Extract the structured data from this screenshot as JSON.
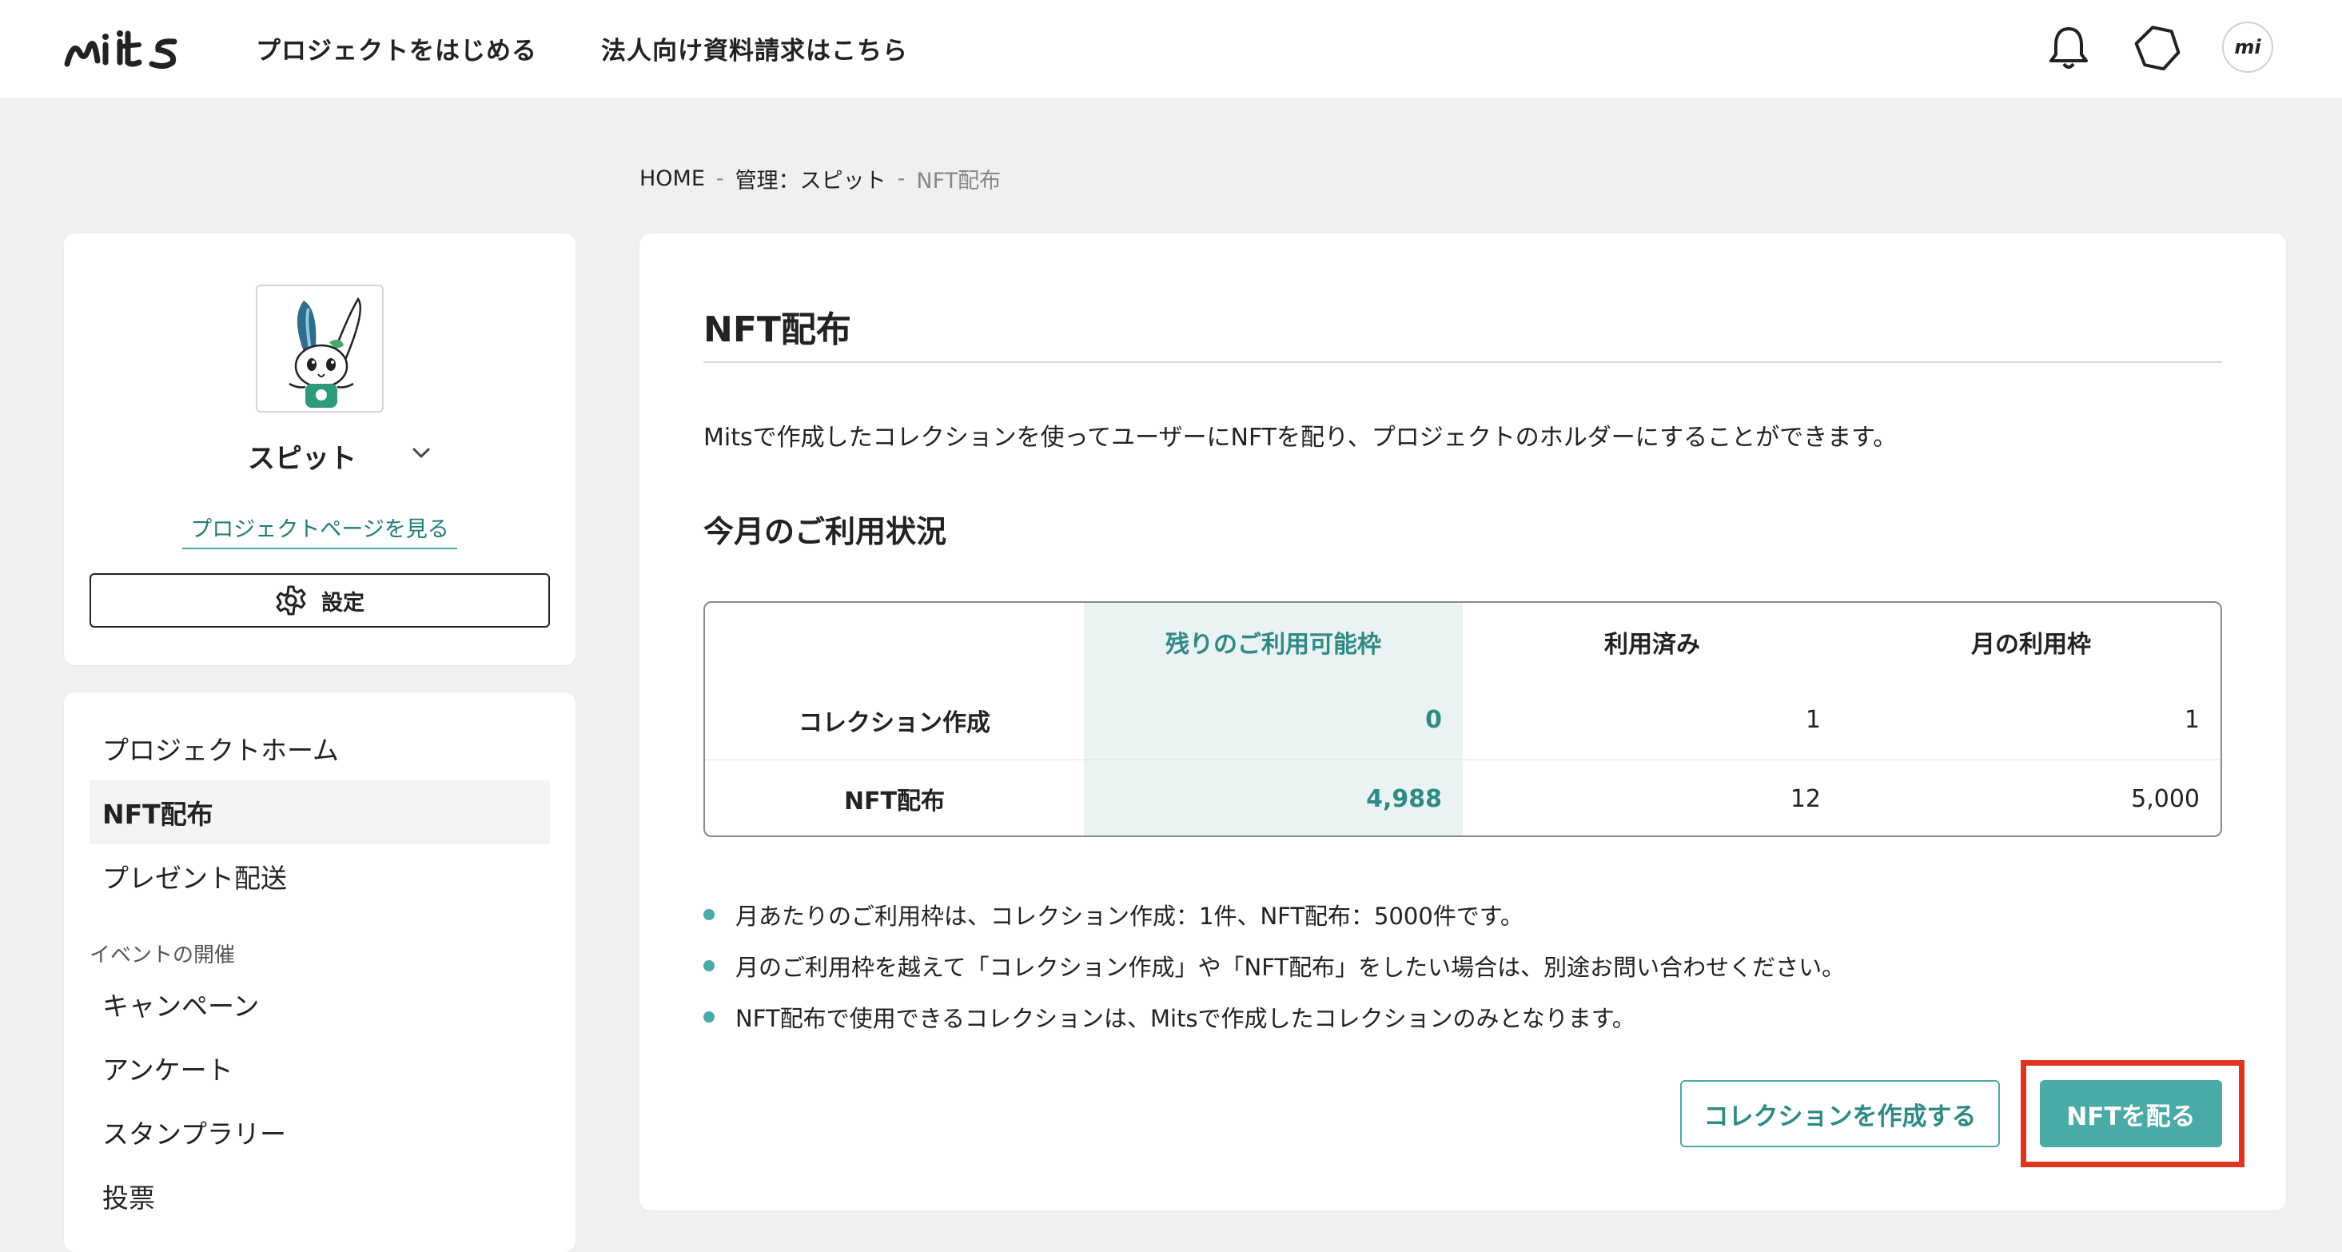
{
  "header": {
    "logo_text": "mits",
    "nav": [
      "プロジェクトをはじめる",
      "法人向け資料請求はこちら"
    ],
    "icons": [
      "bell-icon",
      "hexagon-icon"
    ],
    "avatar_text": "mi"
  },
  "breadcrumb": {
    "home": "HOME",
    "sep": "-",
    "manage": "管理：スピット",
    "current": "NFT配布"
  },
  "sidebar": {
    "project_name": "スピット",
    "project_link": "プロジェクトページを見る",
    "settings_label": "設定",
    "menu": [
      {
        "label": "プロジェクトホーム",
        "active": false
      },
      {
        "label": "NFT配布",
        "active": true
      },
      {
        "label": "プレゼント配送",
        "active": false
      }
    ],
    "section_label": "イベントの開催",
    "events": [
      "キャンペーン",
      "アンケート",
      "スタンプラリー",
      "投票"
    ]
  },
  "main": {
    "title": "NFT配布",
    "description": "Mitsで作成したコレクションを使ってユーザーにNFTを配り、プロジェクトのホルダーにすることができます。",
    "usage_title": "今月のご利用状況",
    "table": {
      "headers": [
        "",
        "残りのご利用可能枠",
        "利用済み",
        "月の利用枠"
      ],
      "rows": [
        {
          "label": "コレクション作成",
          "remaining": "0",
          "used": "1",
          "limit": "1"
        },
        {
          "label": "NFT配布",
          "remaining": "4,988",
          "used": "12",
          "limit": "5,000"
        }
      ]
    },
    "notes": [
      "月あたりのご利用枠は、コレクション作成：1件、NFT配布：5000件です。",
      "月のご利用枠を越えて「コレクション作成」や「NFT配布」をしたい場合は、別途お問い合わせください。",
      "NFT配布で使用できるコレクションは、Mitsで作成したコレクションのみとなります。"
    ],
    "create_collection_label": "コレクションを作成する",
    "distribute_label": "NFTを配る"
  },
  "colors": {
    "accent": "#4aaaa6",
    "accent_dark": "#2f8a85",
    "highlight": "#e0341f",
    "remaining_bg": "#eaf3f2"
  }
}
